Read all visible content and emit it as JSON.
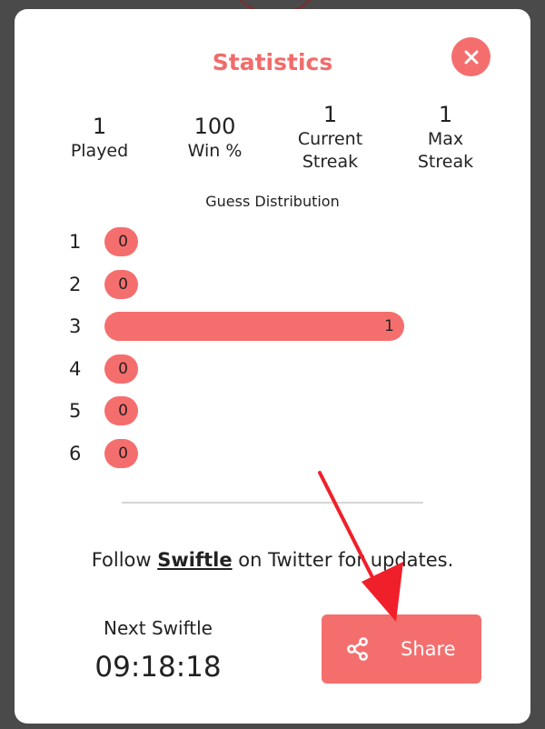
{
  "modal": {
    "title": "Statistics",
    "close_icon": "close-icon",
    "accent_color": "#f56e6e",
    "title_color": "#f26b6b"
  },
  "stats": [
    {
      "value": "1",
      "label": "Played"
    },
    {
      "value": "100",
      "label": "Win %"
    },
    {
      "value": "1",
      "label": "Current Streak"
    },
    {
      "value": "1",
      "label": "Max Streak"
    }
  ],
  "distribution": {
    "title": "Guess Distribution",
    "rows": [
      {
        "guess": "1",
        "count": 0
      },
      {
        "guess": "2",
        "count": 0
      },
      {
        "guess": "3",
        "count": 1
      },
      {
        "guess": "4",
        "count": 0
      },
      {
        "guess": "5",
        "count": 0
      },
      {
        "guess": "6",
        "count": 0
      }
    ]
  },
  "follow": {
    "prefix": "Follow ",
    "link_text": "Swiftle",
    "suffix": " on Twitter for updates."
  },
  "next_game": {
    "label": "Next Swiftle",
    "timer": "09:18:18"
  },
  "share": {
    "label": "Share",
    "icon": "share-icon"
  },
  "annotation": {
    "icon": "arrow-annotation",
    "color": "#f0202a"
  }
}
